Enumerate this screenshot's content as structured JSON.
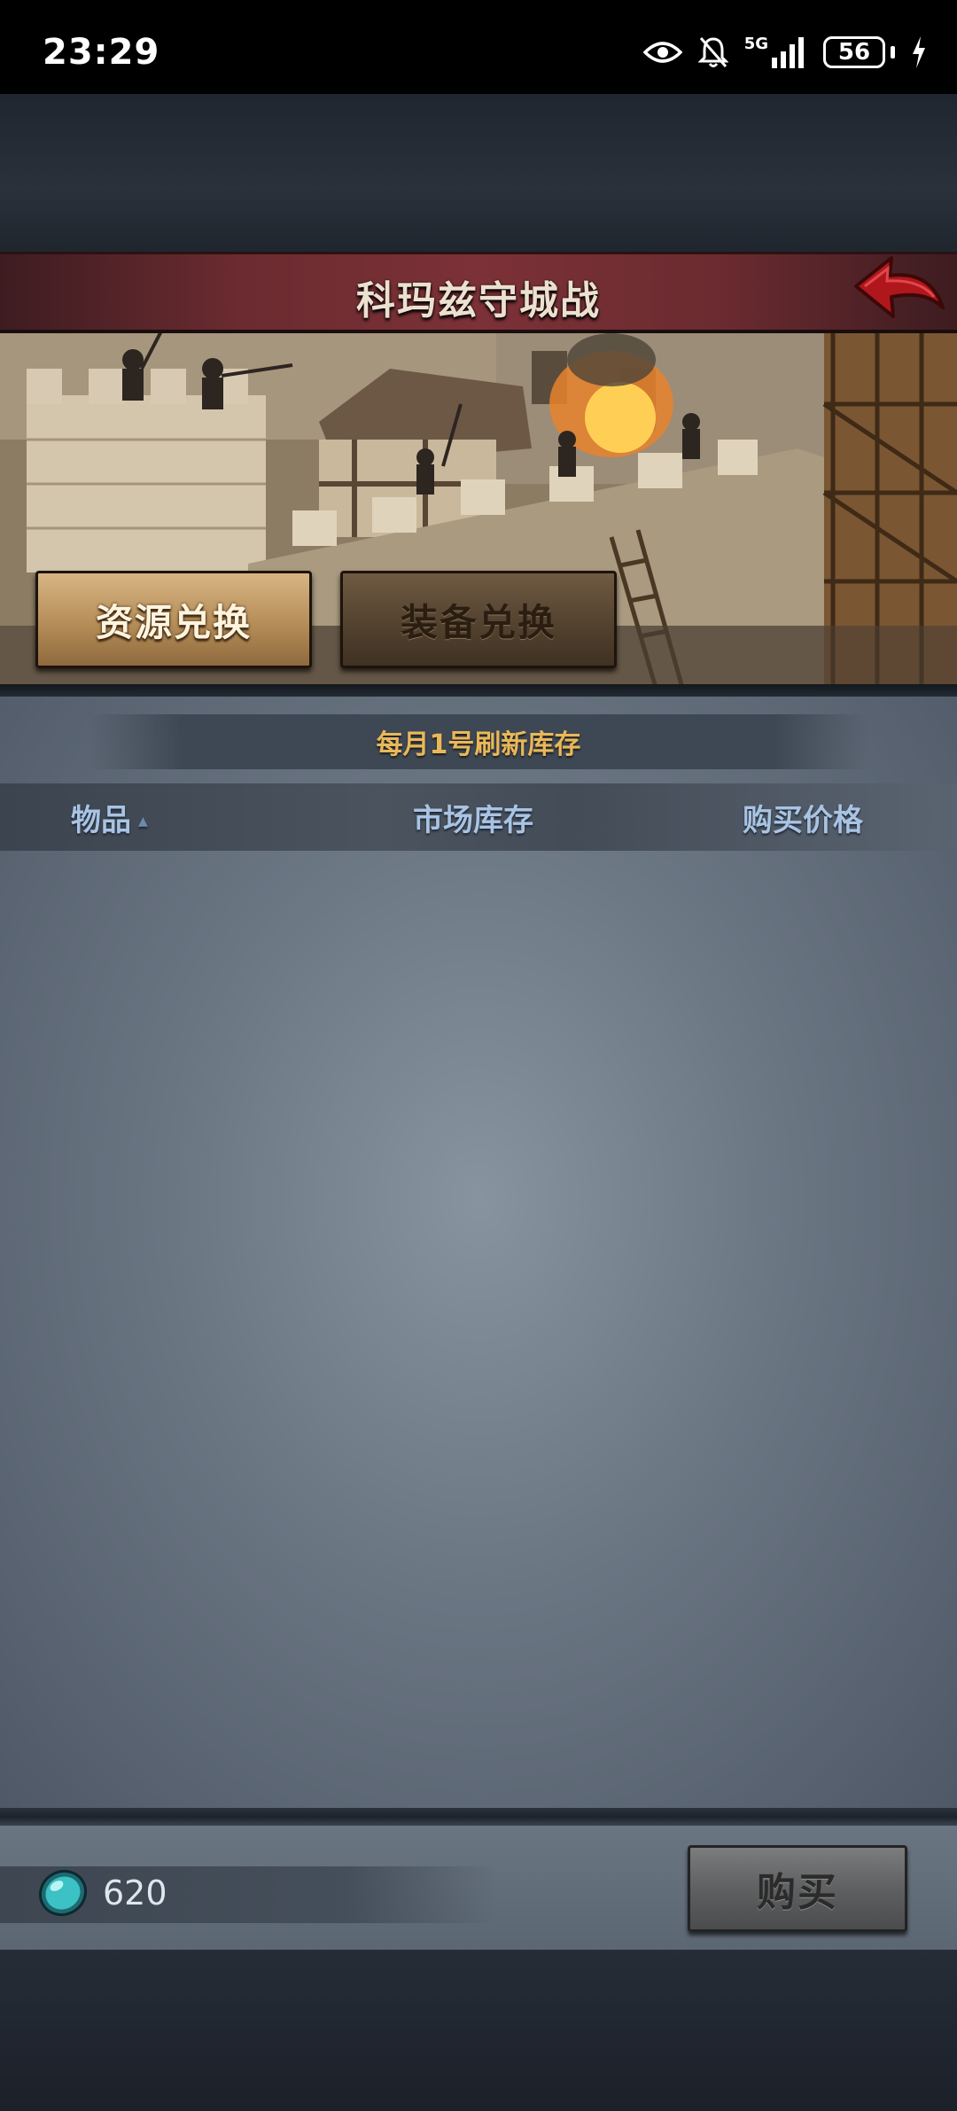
{
  "status_bar": {
    "time": "23:29",
    "network_label": "5G",
    "battery_level": "56"
  },
  "header": {
    "title": "科玛兹守城战",
    "back_icon": "back-arrow-icon"
  },
  "tabs": [
    {
      "label": "资源兑换",
      "active": true
    },
    {
      "label": "装备兑换",
      "active": false
    }
  ],
  "notice": "每月1号刷新库存",
  "table": {
    "columns": [
      "物品",
      "市场库存",
      "购买价格"
    ],
    "rows": []
  },
  "footer": {
    "currency_icon": "gem-icon",
    "currency_amount": "620",
    "buy_label": "购买"
  },
  "colors": {
    "header_red": "#7b3137",
    "notice_gold": "#e9b85a",
    "column_blue": "#a9c3e3",
    "tab_active": "#c9a472"
  }
}
